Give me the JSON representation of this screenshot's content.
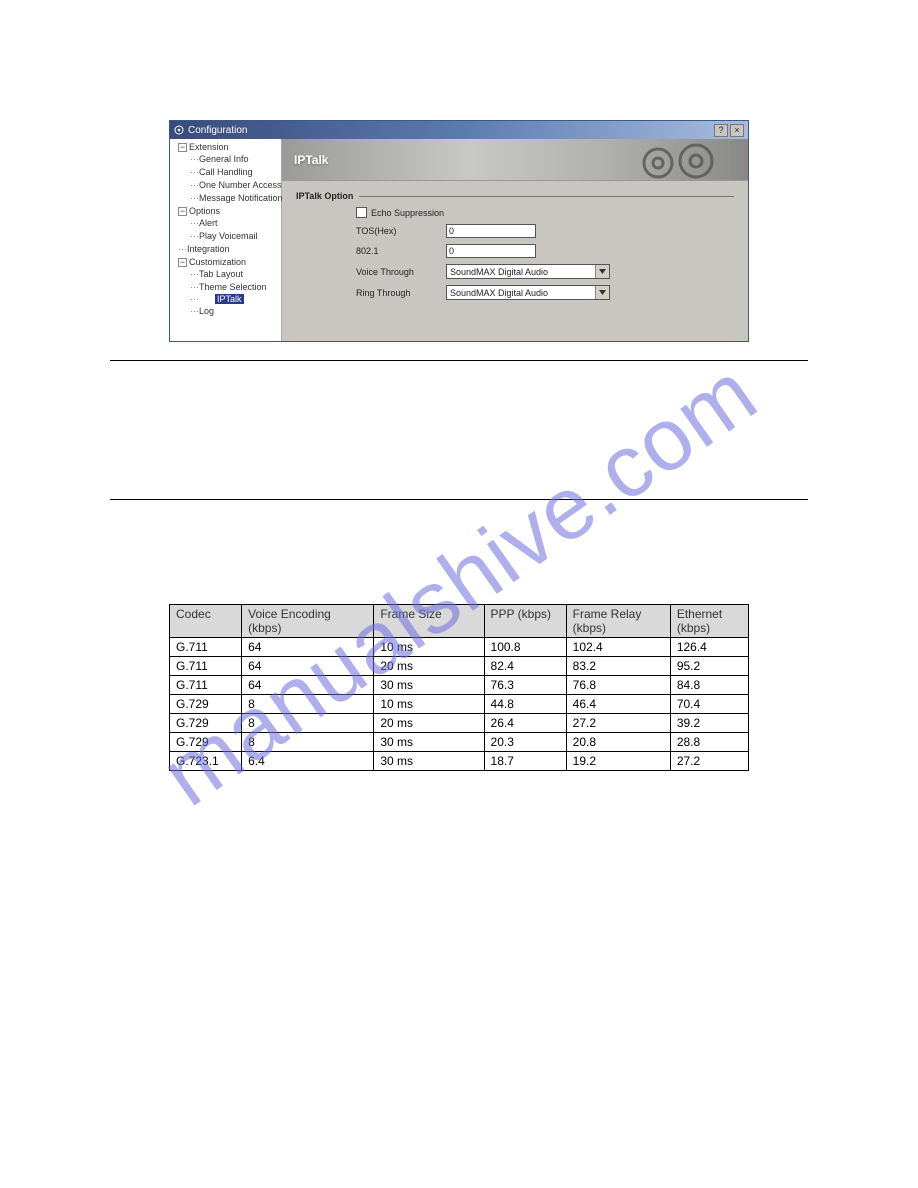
{
  "watermark": "manualshive.com",
  "window": {
    "title": "Configuration",
    "tree": {
      "nodes": [
        {
          "label": "Extension",
          "expanded": true,
          "children": [
            {
              "label": "General Info"
            },
            {
              "label": "Call Handling"
            },
            {
              "label": "One Number Access"
            },
            {
              "label": "Message Notification"
            }
          ]
        },
        {
          "label": "Options",
          "expanded": true,
          "children": [
            {
              "label": "Alert"
            },
            {
              "label": "Play Voicemail"
            }
          ]
        },
        {
          "label": "Integration",
          "leaf": true
        },
        {
          "label": "Customization",
          "expanded": true,
          "children": [
            {
              "label": "Tab Layout"
            },
            {
              "label": "Theme Selection"
            },
            {
              "label": "IPTalk",
              "selected": true
            },
            {
              "label": "Log"
            }
          ]
        }
      ]
    },
    "banner_title": "IPTalk",
    "form": {
      "section": "IPTalk Option",
      "echo_suppression": "Echo Suppression",
      "tos_label": "TOS(Hex)",
      "tos_value": "0",
      "p8021_label": "802.1",
      "p8021_value": "0",
      "voice_through_label": "Voice Through",
      "voice_through_value": "SoundMAX Digital Audio",
      "ring_through_label": "Ring Through",
      "ring_through_value": "SoundMAX Digital Audio"
    },
    "controls": {
      "help": "?",
      "close": "×"
    }
  },
  "chart_data": {
    "type": "table",
    "title": "",
    "columns": [
      "Codec",
      "Voice Encoding (kbps)",
      "Frame Size",
      "PPP (kbps)",
      "Frame Relay (kbps)",
      "Ethernet (kbps)"
    ],
    "rows": [
      [
        "G.711",
        "64",
        "10 ms",
        "100.8",
        "102.4",
        "126.4"
      ],
      [
        "G.711",
        "64",
        "20 ms",
        "82.4",
        "83.2",
        "95.2"
      ],
      [
        "G.711",
        "64",
        "30 ms",
        "76.3",
        "76.8",
        "84.8"
      ],
      [
        "G.729",
        " 8",
        "10 ms",
        "44.8",
        "46.4",
        "70.4"
      ],
      [
        "G.729",
        " 8",
        "20 ms",
        "26.4",
        "27.2",
        "39.2"
      ],
      [
        "G.729",
        " 8",
        "30 ms",
        "20.3",
        "20.8",
        "28.8"
      ],
      [
        "G.723.1",
        "6.4",
        "30 ms",
        "18.7",
        "19.2",
        "27.2"
      ]
    ]
  }
}
